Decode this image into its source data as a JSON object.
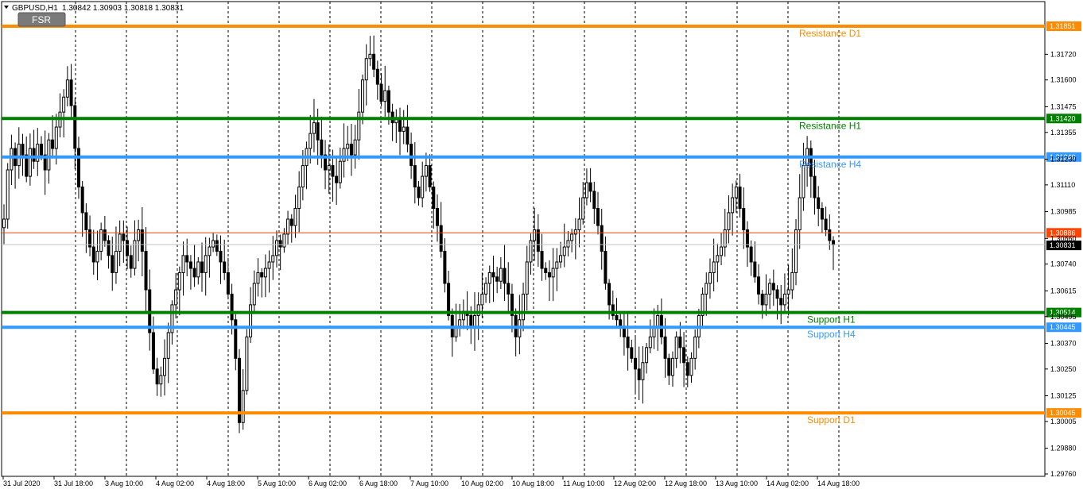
{
  "header": {
    "symbol_label": "GBPUSD,H1",
    "ohlc_text": "1.30842 1.30903 1.30818 1.30831",
    "menu_icon": "triangle-down-icon"
  },
  "fsr_button": {
    "label": "FSR"
  },
  "colors": {
    "resistance_d1": "#ff8c00",
    "support_d1": "#ff8c00",
    "h1": "#008000",
    "h4": "#3399ff",
    "bid_line": "#c0c0c0",
    "ask_line": "#ff4500",
    "candle": "#000000",
    "grid": "#000000"
  },
  "chart_data": {
    "type": "candlestick",
    "title": "",
    "xlabel": "",
    "ylabel": "",
    "ylim": [
      1.2976,
      1.3195
    ],
    "grid": true,
    "y_ticks": [
      "1.31720",
      "1.31600",
      "1.31475",
      "1.31355",
      "1.31230",
      "1.31110",
      "1.30985",
      "1.30860",
      "1.30740",
      "1.30615",
      "1.30495",
      "1.30370",
      "1.30250",
      "1.30125",
      "1.30005",
      "1.29880",
      "1.29760"
    ],
    "x_ticks": [
      "31 Jul 2020",
      "31 Jul 18:00",
      "3 Aug 10:00",
      "4 Aug 02:00",
      "4 Aug 18:00",
      "5 Aug 10:00",
      "6 Aug 02:00",
      "6 Aug 18:00",
      "7 Aug 10:00",
      "10 Aug 02:00",
      "10 Aug 18:00",
      "11 Aug 10:00",
      "12 Aug 02:00",
      "12 Aug 18:00",
      "13 Aug 10:00",
      "14 Aug 02:00",
      "14 Aug 18:00"
    ],
    "levels": [
      {
        "label": "Resistance D1",
        "price": "1.31851",
        "color_key": "resistance_d1"
      },
      {
        "label": "Resistance H1",
        "price": "1.31420",
        "color_key": "h1"
      },
      {
        "label": "Resistance H4",
        "price": "1.31240",
        "color_key": "h4"
      },
      {
        "label": "Support H1",
        "price": "1.30514",
        "color_key": "h1"
      },
      {
        "label": "Support H4",
        "price": "1.30445",
        "color_key": "h4"
      },
      {
        "label": "Support D1",
        "price": "1.30045",
        "color_key": "support_d1"
      }
    ],
    "current_price_tags": [
      {
        "price": "1.30886",
        "color_key": "ask_line"
      },
      {
        "price": "1.30831",
        "color_key": "bid_line"
      }
    ],
    "series_close": [
      1.3095,
      1.3118,
      1.3128,
      1.312,
      1.313,
      1.3125,
      1.3115,
      1.3128,
      1.3122,
      1.313,
      1.3125,
      1.3118,
      1.3132,
      1.3128,
      1.3138,
      1.3145,
      1.3152,
      1.316,
      1.3148,
      1.3128,
      1.311,
      1.3098,
      1.309,
      1.3082,
      1.3075,
      1.308,
      1.309,
      1.3085,
      1.3078,
      1.307,
      1.308,
      1.3088,
      1.3085,
      1.3078,
      1.3072,
      1.3085,
      1.309,
      1.308,
      1.3062,
      1.3042,
      1.3025,
      1.3018,
      1.3022,
      1.303,
      1.3042,
      1.3055,
      1.3062,
      1.307,
      1.3078,
      1.3075,
      1.3072,
      1.3068,
      1.3075,
      1.307,
      1.3078,
      1.3082,
      1.3085,
      1.308,
      1.3075,
      1.307,
      1.306,
      1.3048,
      1.303,
      1.3,
      1.3015,
      1.304,
      1.3055,
      1.3065,
      1.307,
      1.3068,
      1.3072,
      1.3075,
      1.3078,
      1.3085,
      1.3082,
      1.3088,
      1.3095,
      1.3092,
      1.31,
      1.311,
      1.312,
      1.3128,
      1.3135,
      1.314,
      1.3132,
      1.3125,
      1.3118,
      1.312,
      1.3115,
      1.3112,
      1.3122,
      1.3128,
      1.313,
      1.3125,
      1.3132,
      1.3145,
      1.316,
      1.317,
      1.3172,
      1.3165,
      1.3158,
      1.315,
      1.3155,
      1.3145,
      1.314,
      1.3142,
      1.3136,
      1.3138,
      1.313,
      1.312,
      1.311,
      1.3105,
      1.3115,
      1.312,
      1.311,
      1.31,
      1.3092,
      1.308,
      1.3065,
      1.305,
      1.304,
      1.3045,
      1.3048,
      1.3052,
      1.305,
      1.3045,
      1.305,
      1.3055,
      1.306,
      1.3065,
      1.307,
      1.3068,
      1.3066,
      1.3072,
      1.3065,
      1.306,
      1.305,
      1.304,
      1.3048,
      1.306,
      1.3075,
      1.3085,
      1.309,
      1.308,
      1.3072,
      1.307,
      1.3068,
      1.3072,
      1.3075,
      1.3078,
      1.3082,
      1.3085,
      1.3088,
      1.309,
      1.3095,
      1.3105,
      1.3112,
      1.3108,
      1.31,
      1.3092,
      1.308,
      1.3065,
      1.3055,
      1.305,
      1.3048,
      1.3045,
      1.304,
      1.3035,
      1.303,
      1.3025,
      1.302,
      1.3028,
      1.3035,
      1.304,
      1.3045,
      1.305,
      1.304,
      1.303,
      1.3022,
      1.303,
      1.304,
      1.3035,
      1.3028,
      1.3022,
      1.303,
      1.304,
      1.305,
      1.306,
      1.3065,
      1.307,
      1.3075,
      1.3078,
      1.3082,
      1.309,
      1.3098,
      1.3105,
      1.311,
      1.31,
      1.309,
      1.3082,
      1.3075,
      1.3068,
      1.306,
      1.3055,
      1.306,
      1.3065,
      1.3062,
      1.3058,
      1.3055,
      1.306,
      1.3062,
      1.307,
      1.309,
      1.3105,
      1.312,
      1.3128,
      1.3115,
      1.3105,
      1.31,
      1.3095,
      1.309,
      1.3085,
      1.3083
    ]
  }
}
